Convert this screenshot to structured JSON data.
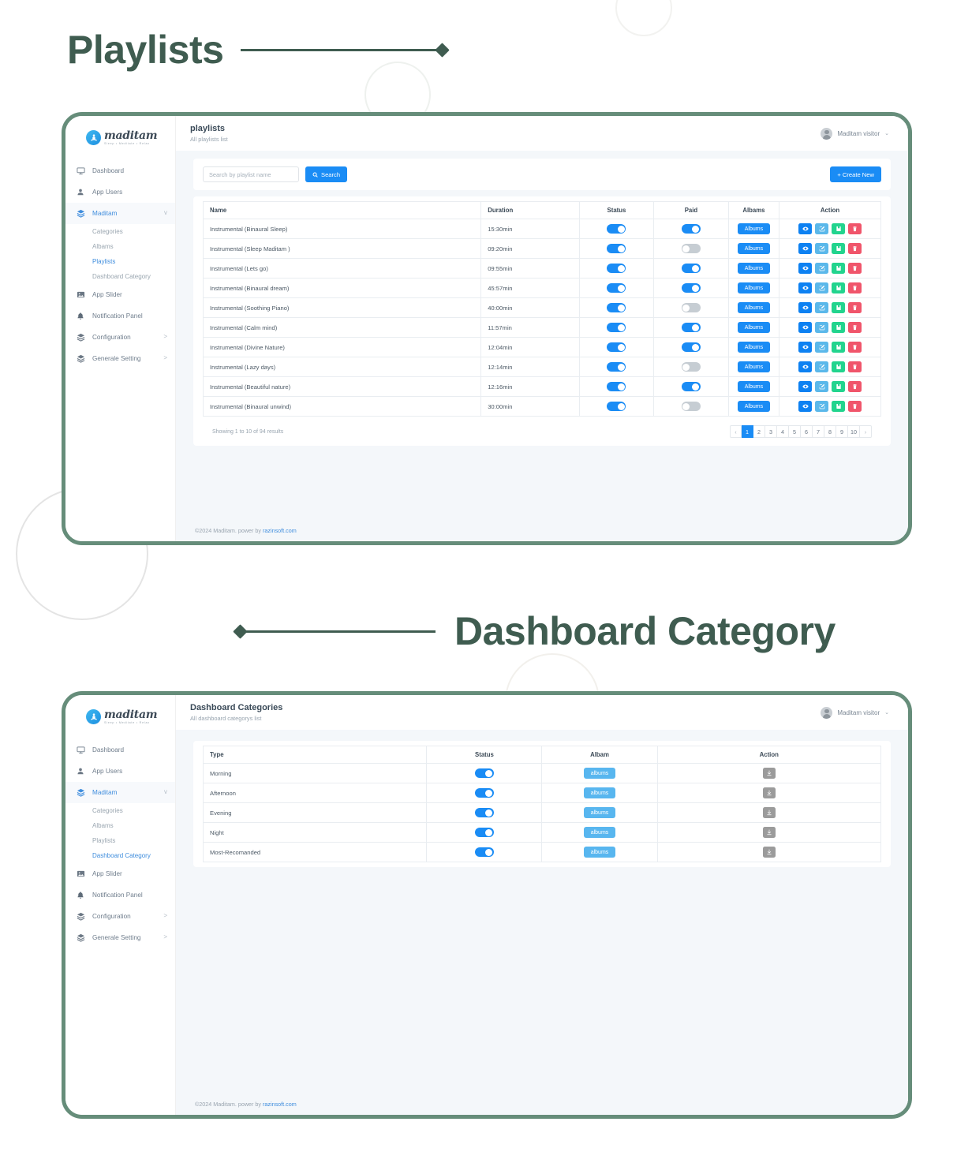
{
  "sections": [
    {
      "id": "playlists",
      "heading": "Playlists"
    },
    {
      "id": "dashcat",
      "heading": "Dashboard  Category"
    }
  ],
  "brand": {
    "name": "maditam",
    "tagline": "Sleep • Meditate • Relax"
  },
  "sidebar": {
    "items": [
      {
        "label": "Dashboard",
        "icon": "monitor-icon",
        "active": false,
        "chevron": ""
      },
      {
        "label": "App Users",
        "icon": "user-icon",
        "active": false,
        "chevron": ""
      },
      {
        "label": "Maditam",
        "icon": "layers-icon",
        "active": true,
        "chevron": "v"
      },
      {
        "label": "App Slider",
        "icon": "image-icon",
        "active": false,
        "chevron": ""
      },
      {
        "label": "Notification Panel",
        "icon": "bell-icon",
        "active": false,
        "chevron": ""
      },
      {
        "label": "Configuration",
        "icon": "layers-icon",
        "active": false,
        "chevron": ">"
      },
      {
        "label": "Generale Setting",
        "icon": "layers-icon",
        "active": false,
        "chevron": ">"
      }
    ],
    "subitems": [
      "Categories",
      "Albams",
      "Playlists",
      "Dashboard Category"
    ]
  },
  "playlists_page": {
    "header": {
      "title": "playlists",
      "subtitle": "All playlists list"
    },
    "user": {
      "name": "Maditam visitor",
      "caret": "⌄"
    },
    "search": {
      "placeholder": "Search by playlist name",
      "value": "",
      "button_label": "Search"
    },
    "create_button": "+ Create New",
    "columns": [
      "Name",
      "Duration",
      "Status",
      "Paid",
      "Albams",
      "Action"
    ],
    "albums_label": "Albums",
    "rows": [
      {
        "name": "Instrumental (Binaural Sleep)",
        "duration": "15:30min",
        "status": true,
        "paid": true
      },
      {
        "name": "Instrumental (Sleep Maditam )",
        "duration": "09:20min",
        "status": true,
        "paid": false
      },
      {
        "name": "Instrumental (Lets go)",
        "duration": "09:55min",
        "status": true,
        "paid": true
      },
      {
        "name": "Instrumental (Binaural dream)",
        "duration": "45:57min",
        "status": true,
        "paid": true
      },
      {
        "name": "Instrumental (Soothing Piano)",
        "duration": "40:00min",
        "status": true,
        "paid": false
      },
      {
        "name": "Instrumental (Calm mind)",
        "duration": "11:57min",
        "status": true,
        "paid": true
      },
      {
        "name": "Instrumental (Divine Nature)",
        "duration": "12:04min",
        "status": true,
        "paid": true
      },
      {
        "name": "Instrumental (Lazy days)",
        "duration": "12:14min",
        "status": true,
        "paid": false
      },
      {
        "name": "Instrumental (Beautiful nature)",
        "duration": "12:16min",
        "status": true,
        "paid": true
      },
      {
        "name": "Instrumental (Binaural unwind)",
        "duration": "30:00min",
        "status": true,
        "paid": false
      }
    ],
    "showing": "Showing 1 to 10 of 94 results",
    "pagination": {
      "prev": "‹",
      "pages": [
        "1",
        "2",
        "3",
        "4",
        "5",
        "6",
        "7",
        "8",
        "9",
        "10"
      ],
      "next": "›",
      "current": "1"
    },
    "footer": {
      "text": "©2024 Maditam. power by ",
      "link": "razinsoft.com"
    }
  },
  "dashcat_page": {
    "header": {
      "title": "Dashboard Categories",
      "subtitle": "All dashboard categorys list"
    },
    "user": {
      "name": "Maditam visitor",
      "caret": "⌄"
    },
    "columns": [
      "Type",
      "Status",
      "Albam",
      "Action"
    ],
    "albums_label": "albums",
    "rows": [
      {
        "type": "Morning",
        "status": true
      },
      {
        "type": "Afternoon",
        "status": true
      },
      {
        "type": "Evening",
        "status": true
      },
      {
        "type": "Night",
        "status": true
      },
      {
        "type": "Most-Recomanded",
        "status": true
      }
    ],
    "footer": {
      "text": "©2024 Maditam. power by ",
      "link": "razinsoft.com"
    }
  },
  "colors": {
    "frame_green": "#668d7a",
    "heading": "#3f5c50",
    "accent_blue": "#1a8cf5",
    "toggle_on": "#1a8cf5",
    "toggle_off": "#c6cdd3",
    "action_view": "#0d81f2",
    "action_edit": "#5bb8ea",
    "action_book": "#22d48e",
    "action_delete": "#f0556b",
    "action_download": "#9b9b9b",
    "page_bg": "#f4f7fa"
  }
}
